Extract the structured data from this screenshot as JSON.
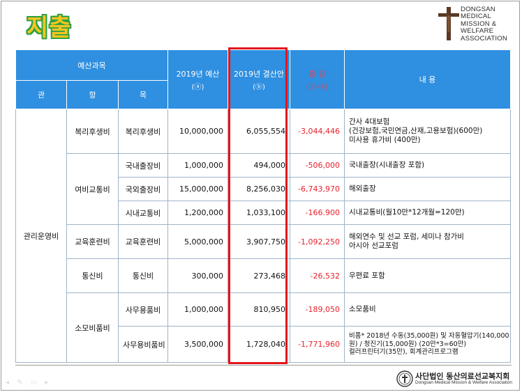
{
  "title": "지출",
  "logo": {
    "lines": [
      "DONGSAN",
      "MEDICAL",
      "MISSION &",
      "WELFARE",
      "ASSOCIATION"
    ]
  },
  "table": {
    "header": {
      "budget_subject": "예산과목",
      "gwan": "관",
      "hang": "항",
      "mok": "목",
      "budget_2019": "2019년 예산",
      "budget_2019_sub": "(ⓐ)",
      "settlement_2019": "2019년 결산안",
      "settlement_2019_sub": "(ⓑ)",
      "diff": "증 감",
      "diff_sub": "(ⓑ-ⓐ)",
      "content": "내 용"
    },
    "gwan": "관리운영비",
    "rows": [
      {
        "hang": "복리후생비",
        "mok": "복리후생비",
        "budget": "10,000,000",
        "settlement": "6,055,554",
        "diff": "-3,044,446",
        "content": [
          "간사 4대보험",
          "(건강보험,국민연금,산재,고용보험)(600만)",
          "미사용 휴가비 (400만)"
        ]
      },
      {
        "hang": "여비교통비",
        "mok": "국내출장비",
        "budget": "1,000,000",
        "settlement": "494,000",
        "diff": "-506,000",
        "content": [
          "국내출장(시내출장 포함)"
        ]
      },
      {
        "hang": "",
        "mok": "국외출장비",
        "budget": "15,000,000",
        "settlement": "8,256,030",
        "diff": "-6,743,970",
        "content": [
          "해외출장"
        ]
      },
      {
        "hang": "",
        "mok": "시내교통비",
        "budget": "1,200,000",
        "settlement": "1,033,100",
        "diff": "-166.900",
        "content": [
          "시내교통비(월10만*12개월=120만)"
        ]
      },
      {
        "hang": "교육훈련비",
        "mok": "교육훈련비",
        "budget": "5,000,000",
        "settlement": "3,907,750",
        "diff": "-1,092,250",
        "content": [
          "해외연수 및 선교 포럼, 세미나 참가비",
          "아시아 선교포럼"
        ]
      },
      {
        "hang": "통신비",
        "mok": "통신비",
        "budget": "300,000",
        "settlement": "273,468",
        "diff": "-26,532",
        "content": [
          "우편료 포함"
        ]
      },
      {
        "hang": "소모비품비",
        "mok": "사무용품비",
        "budget": "1,000,000",
        "settlement": "810,950",
        "diff": "-189,050",
        "content": [
          "소모품비"
        ]
      },
      {
        "hang": "",
        "mok": "사무용비품비",
        "budget": "3,500,000",
        "settlement": "1,728,040",
        "diff": "-1,771,960",
        "content": [
          "비품* 2018년 수동(35,000원) 및 자동혈압기(140,000",
          "원) / 청진기(15,000원) (20만*3=60만)",
          "컬러프린터기(35만), 회계관리프로그램"
        ]
      }
    ]
  },
  "footer": {
    "name": "사단법인 동산의료선교복지회",
    "english": "Dongsan Medical Mission & Welfare Association"
  }
}
